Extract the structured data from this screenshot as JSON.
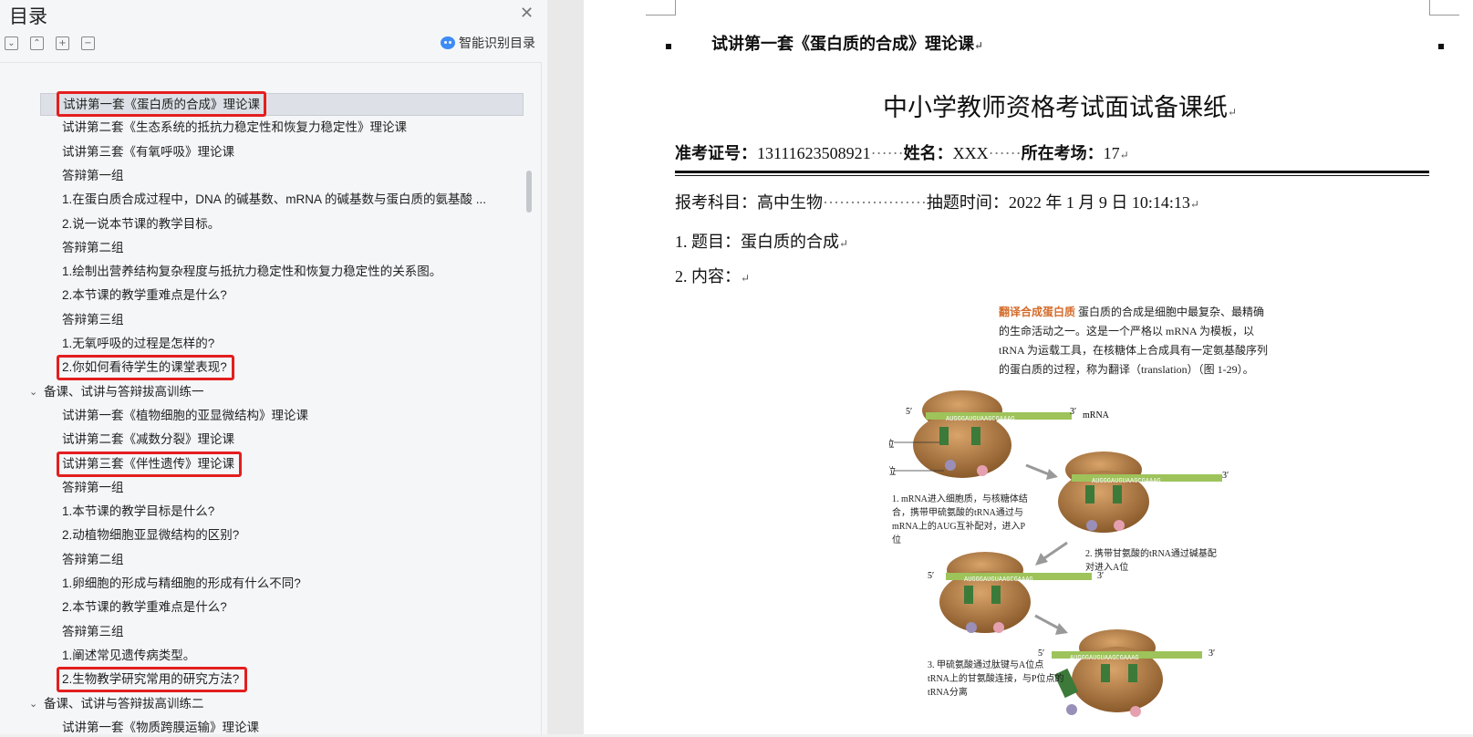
{
  "toc": {
    "title": "目录",
    "smart_label": "智能识别目录",
    "toolbar": [
      "⌄",
      "⌃",
      "+",
      "−"
    ],
    "items": [
      {
        "text": "试讲第一套《蛋白质的合成》理论课",
        "level": 2,
        "selected": true,
        "highlight": true
      },
      {
        "text": "试讲第二套《生态系统的抵抗力稳定性和恢复力稳定性》理论课",
        "level": 2
      },
      {
        "text": "试讲第三套《有氧呼吸》理论课",
        "level": 2
      },
      {
        "text": "答辩第一组",
        "level": 2
      },
      {
        "text": "1.在蛋白质合成过程中，DNA 的碱基数、mRNA 的碱基数与蛋白质的氨基酸 ...",
        "level": 2
      },
      {
        "text": "2.说一说本节课的教学目标。",
        "level": 2
      },
      {
        "text": "答辩第二组",
        "level": 2
      },
      {
        "text": "1.绘制出营养结构复杂程度与抵抗力稳定性和恢复力稳定性的关系图。",
        "level": 2
      },
      {
        "text": "2.本节课的教学重难点是什么?",
        "level": 2
      },
      {
        "text": "答辩第三组",
        "level": 2
      },
      {
        "text": "1.无氧呼吸的过程是怎样的?",
        "level": 2
      },
      {
        "text": "2.你如何看待学生的课堂表现?",
        "level": 2,
        "highlight": true
      },
      {
        "text": "备课、试讲与答辩拔高训练一",
        "level": 1,
        "expanded": true
      },
      {
        "text": "试讲第一套《植物细胞的亚显微结构》理论课",
        "level": 2
      },
      {
        "text": "试讲第二套《减数分裂》理论课",
        "level": 2
      },
      {
        "text": "试讲第三套《伴性遗传》理论课",
        "level": 2,
        "highlight": true
      },
      {
        "text": "答辩第一组",
        "level": 2
      },
      {
        "text": "1.本节课的教学目标是什么?",
        "level": 2
      },
      {
        "text": "2.动植物细胞亚显微结构的区别?",
        "level": 2
      },
      {
        "text": "答辩第二组",
        "level": 2
      },
      {
        "text": "1.卵细胞的形成与精细胞的形成有什么不同?",
        "level": 2
      },
      {
        "text": "2.本节课的教学重难点是什么?",
        "level": 2
      },
      {
        "text": "答辩第三组",
        "level": 2
      },
      {
        "text": "1.阐述常见遗传病类型。",
        "level": 2
      },
      {
        "text": "2.生物教学研究常用的研究方法?",
        "level": 2,
        "highlight": true
      },
      {
        "text": "备课、试讲与答辩拔高训练二",
        "level": 1,
        "expanded": true
      },
      {
        "text": "试讲第一套《物质跨膜运输》理论课",
        "level": 2
      }
    ]
  },
  "doc": {
    "header": "试讲第一套《蛋白质的合成》理论课",
    "title": "中小学教师资格考试面试备课纸",
    "info": {
      "id_label": "准考证号：",
      "id_value": "13111623508921",
      "name_label": "姓名：",
      "name_value": "XXX",
      "site_label": "所在考场：",
      "site_value": "17"
    },
    "subject_line": "报考科目：高中生物",
    "time_line": "抽题时间：2022 年 1 月 9 日 10:14:13",
    "topic": "1. 题目：蛋白质的合成",
    "content": "2. 内容：",
    "figure": {
      "lead_em": "翻译合成蛋白质",
      "lead_text": "蛋白质的合成是细胞中最复杂、最精确的生命活动之一。这是一个严格以 mRNA 为模板，以 tRNA 为运载工具，在核糖体上合成具有一定氨基酸序列的蛋白质的过程，称为翻译（translation）（图 1-29）。",
      "mrna_label": "mRNA",
      "p_site": "P位",
      "a_site": "A位",
      "seq1": "AUGGGAUGUAAGCGAAAG",
      "seq2": "AUGGGAUGUAAGCGAAAG",
      "seq3": "AUGGGAUGUAAGCGAAAG",
      "seq4": "AUGGGAUGUAAGCGAAAG",
      "cap1": "1. mRNA进入细胞质，与核糖体结合，携带甲硫氨酸的tRNA通过与mRNA上的AUG互补配对，进入P位",
      "cap2": "2. 携带甘氨酸的tRNA通过碱基配对进入A位",
      "cap3": "3. 甲硫氨酸通过肽键与A位点tRNA上的甘氨酸连接，与P位点的tRNA分离",
      "five": "5′",
      "three": "3′"
    },
    "colors": {
      "highlight": "#e41e1e",
      "ribosome": "#b07a44",
      "mrna": "#9dc35a"
    }
  }
}
